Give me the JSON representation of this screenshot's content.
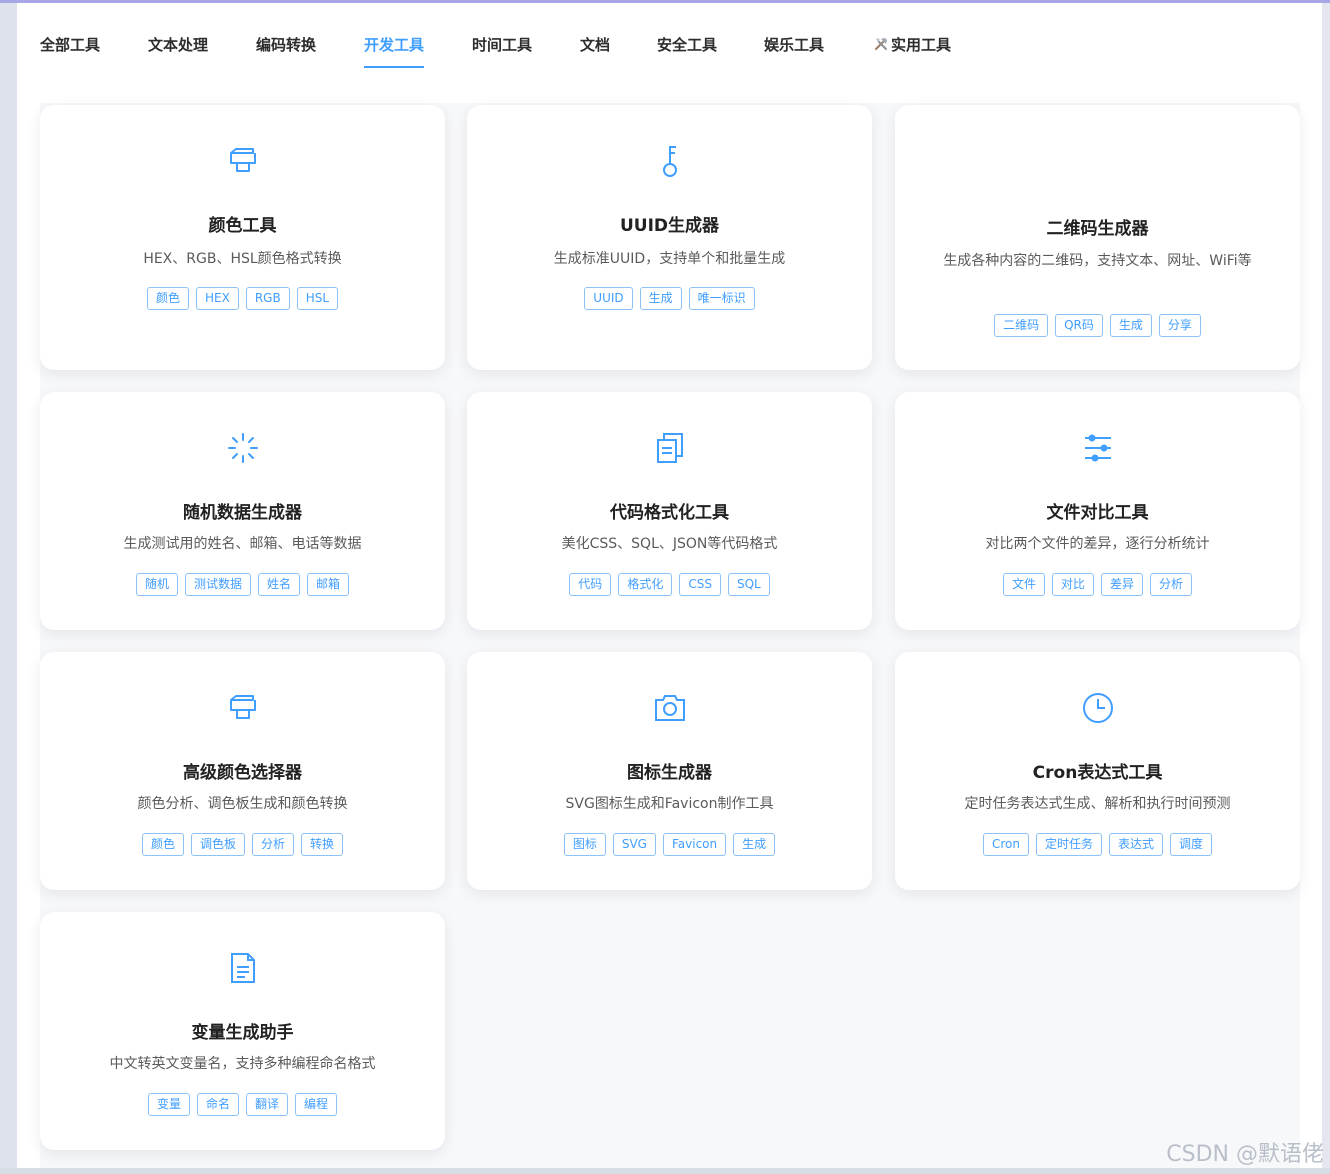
{
  "tabs": [
    {
      "label": "全部工具"
    },
    {
      "label": "文本处理"
    },
    {
      "label": "编码转换"
    },
    {
      "label": "开发工具",
      "active": true
    },
    {
      "label": "时间工具"
    },
    {
      "label": "文档"
    },
    {
      "label": "安全工具"
    },
    {
      "label": "娱乐工具"
    },
    {
      "label": "实用工具",
      "icon": "hammer-wrench-icon"
    }
  ],
  "cards": [
    {
      "icon": "color-palette-icon",
      "title": "颜色工具",
      "desc": "HEX、RGB、HSL颜色格式转换",
      "tags": [
        "颜色",
        "HEX",
        "RGB",
        "HSL"
      ]
    },
    {
      "icon": "key-icon",
      "title": "UUID生成器",
      "desc": "生成标准UUID，支持单个和批量生成",
      "tags": [
        "UUID",
        "生成",
        "唯一标识"
      ]
    },
    {
      "icon": "none",
      "title": "二维码生成器",
      "desc": "生成各种内容的二维码，支持文本、网址、WiFi等",
      "tags": [
        "二维码",
        "QR码",
        "生成",
        "分享"
      ]
    },
    {
      "icon": "loading-spark-icon",
      "title": "随机数据生成器",
      "desc": "生成测试用的姓名、邮箱、电话等数据",
      "tags": [
        "随机",
        "测试数据",
        "姓名",
        "邮箱"
      ]
    },
    {
      "icon": "document-copy-icon",
      "title": "代码格式化工具",
      "desc": "美化CSS、SQL、JSON等代码格式",
      "tags": [
        "代码",
        "格式化",
        "CSS",
        "SQL"
      ]
    },
    {
      "icon": "sliders-icon",
      "title": "文件对比工具",
      "desc": "对比两个文件的差异，逐行分析统计",
      "tags": [
        "文件",
        "对比",
        "差异",
        "分析"
      ]
    },
    {
      "icon": "color-palette-icon",
      "title": "高级颜色选择器",
      "desc": "颜色分析、调色板生成和颜色转换",
      "tags": [
        "颜色",
        "调色板",
        "分析",
        "转换"
      ]
    },
    {
      "icon": "camera-icon",
      "title": "图标生成器",
      "desc": "SVG图标生成和Favicon制作工具",
      "tags": [
        "图标",
        "SVG",
        "Favicon",
        "生成"
      ]
    },
    {
      "icon": "clock-icon",
      "title": "Cron表达式工具",
      "desc": "定时任务表达式生成、解析和执行时间预测",
      "tags": [
        "Cron",
        "定时任务",
        "表达式",
        "调度"
      ]
    },
    {
      "icon": "document-icon",
      "title": "变量生成助手",
      "desc": "中文转英文变量名，支持多种编程命名格式",
      "tags": [
        "变量",
        "命名",
        "翻译",
        "编程"
      ]
    }
  ],
  "watermark": "CSDN @默语佬",
  "colors": {
    "accent": "#409eff",
    "tag_border": "#8cc2f7",
    "title": "#222222",
    "desc": "#5a5a5a"
  }
}
